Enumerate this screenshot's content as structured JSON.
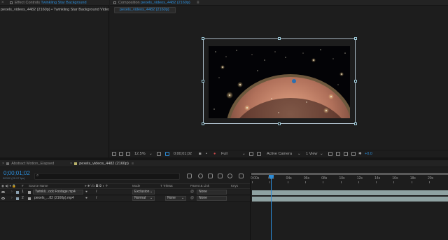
{
  "effect_controls": {
    "tab_label": "Effect Controls",
    "tab_layer": "Twinkling Star Background",
    "subtitle": "pexels_videos_4482 (2160p) • Twinkling Star Background Video"
  },
  "composition": {
    "tab_label": "Composition",
    "tab_comp": "pexels_videos_4482 (2160p)",
    "subtab": "pexels_videos_4482 (2160p)"
  },
  "viewer_toolbar": {
    "zoom": "12.5%",
    "timecode": "0;00;01;02",
    "resolution": "Full",
    "camera": "Active Camera",
    "views": "1 View",
    "exposure": "+0.0"
  },
  "timeline": {
    "tabs": [
      {
        "label": "Abstract Motion_Elapsed"
      },
      {
        "label": "pexels_videos_4482 (2160p)"
      }
    ],
    "timecode": "0;00;01;02",
    "frames": "00032 (29.97 fps)",
    "columns": {
      "num": "#",
      "source_name": "Source Name",
      "mode": "Mode",
      "trkmat": "T TrkMat",
      "parent": "Parent & Link",
      "keys": "Keys"
    },
    "layers": [
      {
        "num": "1",
        "name": "Twinkli...ock Footage.mp4",
        "mode": "Exclusion",
        "trkmat": "",
        "parent": "None"
      },
      {
        "num": "2",
        "name": "pexels_...82 (2160p).mp4",
        "mode": "Normal",
        "trkmat": "None",
        "parent": "None"
      }
    ],
    "ruler_ticks": [
      "0:00s",
      "02s",
      "04s",
      "06s",
      "08s",
      "10s",
      "12s",
      "14s",
      "16s",
      "18s",
      "20s"
    ]
  }
}
